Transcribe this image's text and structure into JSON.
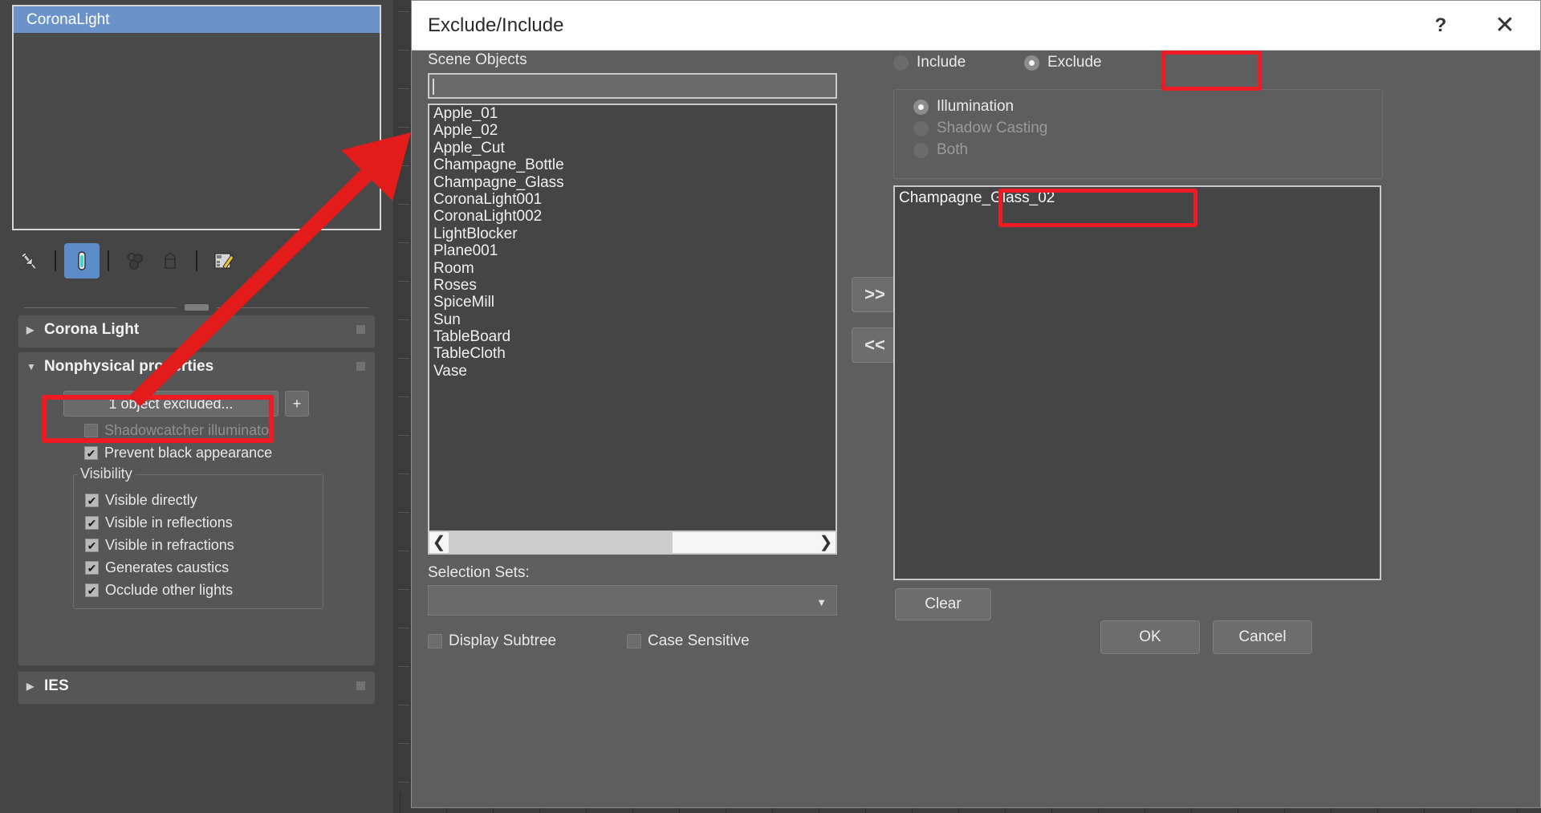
{
  "command_panel": {
    "selection_list": {
      "items": [
        "CoronaLight"
      ]
    },
    "toolbar": {
      "buttons": [
        {
          "name": "pin-stack-icon",
          "glyph": "pin"
        },
        {
          "name": "separator",
          "glyph": "sep"
        },
        {
          "name": "modify-tab-icon",
          "glyph": "tube",
          "active": true
        },
        {
          "name": "separator",
          "glyph": "sep"
        },
        {
          "name": "material-icon",
          "glyph": "atoms"
        },
        {
          "name": "delete-icon",
          "glyph": "trash"
        },
        {
          "name": "separator",
          "glyph": "sep"
        },
        {
          "name": "edit-icon",
          "glyph": "edit"
        }
      ]
    },
    "rollouts": [
      {
        "title": "Corona Light",
        "expanded": false
      },
      {
        "title": "Nonphysical properties",
        "expanded": true
      },
      {
        "title": "IES",
        "expanded": false
      }
    ],
    "nonphysical": {
      "exclude_button_label": "1 object excluded...",
      "plus_button_label": "+",
      "checkboxes": [
        {
          "label": "Shadowcatcher illuminator",
          "checked": false,
          "disabled": true
        },
        {
          "label": "Prevent black appearance",
          "checked": true,
          "disabled": false
        }
      ],
      "visibility_group": {
        "title": "Visibility",
        "checkboxes": [
          {
            "label": "Visible directly",
            "checked": true
          },
          {
            "label": "Visible in reflections",
            "checked": true
          },
          {
            "label": "Visible in refractions",
            "checked": true
          },
          {
            "label": "Generates caustics",
            "checked": true
          },
          {
            "label": "Occlude other lights",
            "checked": true
          }
        ]
      }
    }
  },
  "dialog": {
    "title": "Exclude/Include",
    "help_button": "?",
    "close_button": "✕",
    "scene_objects_label": "Scene Objects",
    "search_value": "",
    "search_placeholder": "",
    "scene_objects": [
      "Apple_01",
      "Apple_02",
      "Apple_Cut",
      "Champagne_Bottle",
      "Champagne_Glass",
      "CoronaLight001",
      "CoronaLight002",
      "LightBlocker",
      "Plane001",
      "Room",
      "Roses",
      "SpiceMill",
      "Sun",
      "TableBoard",
      "TableCloth",
      "Vase"
    ],
    "hscroll": {
      "left_arrow": "❮",
      "right_arrow": "❯",
      "thumb_percent": 61
    },
    "selection_sets_label": "Selection Sets:",
    "selection_sets_value": "",
    "selection_sets_arrow": "▼",
    "footer_checkboxes": [
      {
        "label": "Display Subtree",
        "checked": false
      },
      {
        "label": "Case Sensitive",
        "checked": false
      }
    ],
    "transfer_buttons": [
      {
        "label": ">>",
        "name": "add-button"
      },
      {
        "label": "<<",
        "name": "remove-button"
      }
    ],
    "mode_radios": [
      {
        "label": "Include",
        "selected": false
      },
      {
        "label": "Exclude",
        "selected": true
      }
    ],
    "effect_radios": [
      {
        "label": "Illumination",
        "selected": true,
        "disabled": false
      },
      {
        "label": "Shadow Casting",
        "selected": false,
        "disabled": true
      },
      {
        "label": "Both",
        "selected": false,
        "disabled": true
      }
    ],
    "excluded_objects": [
      "Champagne_Glass_02"
    ],
    "clear_button": "Clear",
    "ok_button": "OK",
    "cancel_button": "Cancel"
  },
  "annotations": {
    "highlight_color": "#ed1c24",
    "arrow_color": "#e31b1b",
    "boxes": [
      {
        "name": "highlight-exclude-button"
      },
      {
        "name": "highlight-exclude-radio"
      },
      {
        "name": "highlight-excluded-item"
      }
    ]
  }
}
